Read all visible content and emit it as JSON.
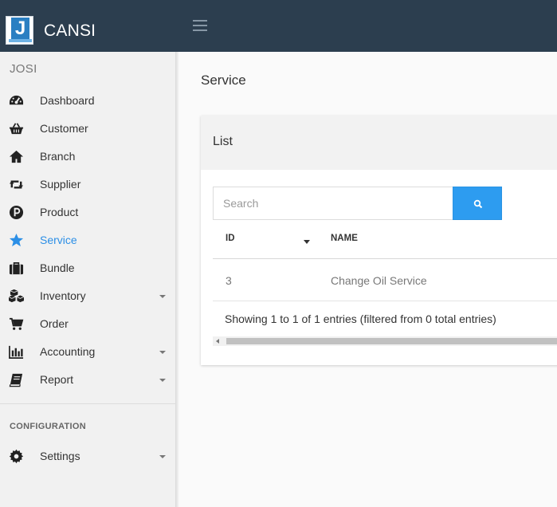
{
  "header": {
    "brand": "CANSI",
    "logo_letter": "J"
  },
  "sidebar": {
    "user": "JOSI",
    "items": [
      {
        "label": "Dashboard",
        "icon": "dashboard-icon"
      },
      {
        "label": "Customer",
        "icon": "basket-icon"
      },
      {
        "label": "Branch",
        "icon": "home-icon"
      },
      {
        "label": "Supplier",
        "icon": "retweet-icon"
      },
      {
        "label": "Product",
        "icon": "product-p-icon"
      },
      {
        "label": "Service",
        "icon": "star-icon",
        "active": true
      },
      {
        "label": "Bundle",
        "icon": "suitcase-icon"
      },
      {
        "label": "Inventory",
        "icon": "cubes-icon",
        "has_submenu": true
      },
      {
        "label": "Order",
        "icon": "cart-icon"
      },
      {
        "label": "Accounting",
        "icon": "bar-chart-icon",
        "has_submenu": true
      },
      {
        "label": "Report",
        "icon": "book-icon",
        "has_submenu": true
      }
    ],
    "config_section": {
      "title": "CONFIGURATION",
      "items": [
        {
          "label": "Settings",
          "icon": "gear-icon",
          "has_submenu": true
        }
      ]
    }
  },
  "main": {
    "page_title": "Service",
    "card": {
      "title": "List",
      "search": {
        "placeholder": "Search",
        "value": ""
      },
      "columns": [
        "ID",
        "NAME"
      ],
      "rows": [
        {
          "id": "3",
          "name": "Change Oil Service"
        }
      ],
      "info": "Showing 1 to 1 of 1 entries (filtered from 0 total entries)"
    }
  },
  "colors": {
    "topbar": "#2c3e4f",
    "accent": "#2c8fe6",
    "search_button": "#2d9cf0"
  }
}
